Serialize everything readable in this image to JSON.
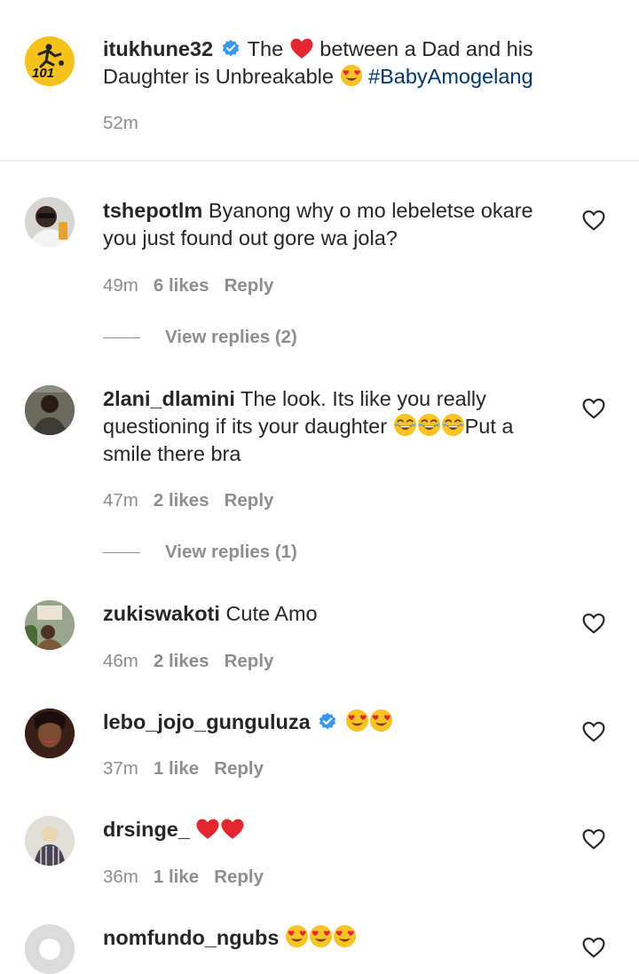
{
  "post": {
    "username": "itukhune32",
    "caption_pre": "The",
    "caption_post": "between a Dad and his",
    "caption_line2": "Daughter is Unbreakable",
    "hashtag": "#BabyAmogelang",
    "time": "52m",
    "avatar_text": "101"
  },
  "comments": [
    {
      "username": "tshepotlm",
      "text1": "Byanong why o mo lebeletse okare",
      "text2": "you just found out gore wa jola?",
      "time": "49m",
      "likes": "6 likes",
      "reply": "Reply",
      "view_replies": "View replies (2)"
    },
    {
      "username": "2lani_dlamini",
      "text1": "The look. Its like you really",
      "text2": "questioning if its your daughter",
      "text2b": "Put a",
      "text3": "smile there bra",
      "time": "47m",
      "likes": "2 likes",
      "reply": "Reply",
      "view_replies": "View replies (1)"
    },
    {
      "username": "zukiswakoti",
      "text1": "Cute Amo",
      "time": "46m",
      "likes": "2 likes",
      "reply": "Reply"
    },
    {
      "username": "lebo_jojo_gunguluza",
      "time": "37m",
      "likes": "1 like",
      "reply": "Reply"
    },
    {
      "username": "drsinge_",
      "time": "36m",
      "likes": "1 like",
      "reply": "Reply"
    },
    {
      "username": "nomfundo_ngubs"
    }
  ],
  "colors": {
    "text": "#262626",
    "meta": "#8e8e8e",
    "hashtag": "#00376b",
    "verified": "#3897f0",
    "heart": "#ed4956"
  }
}
